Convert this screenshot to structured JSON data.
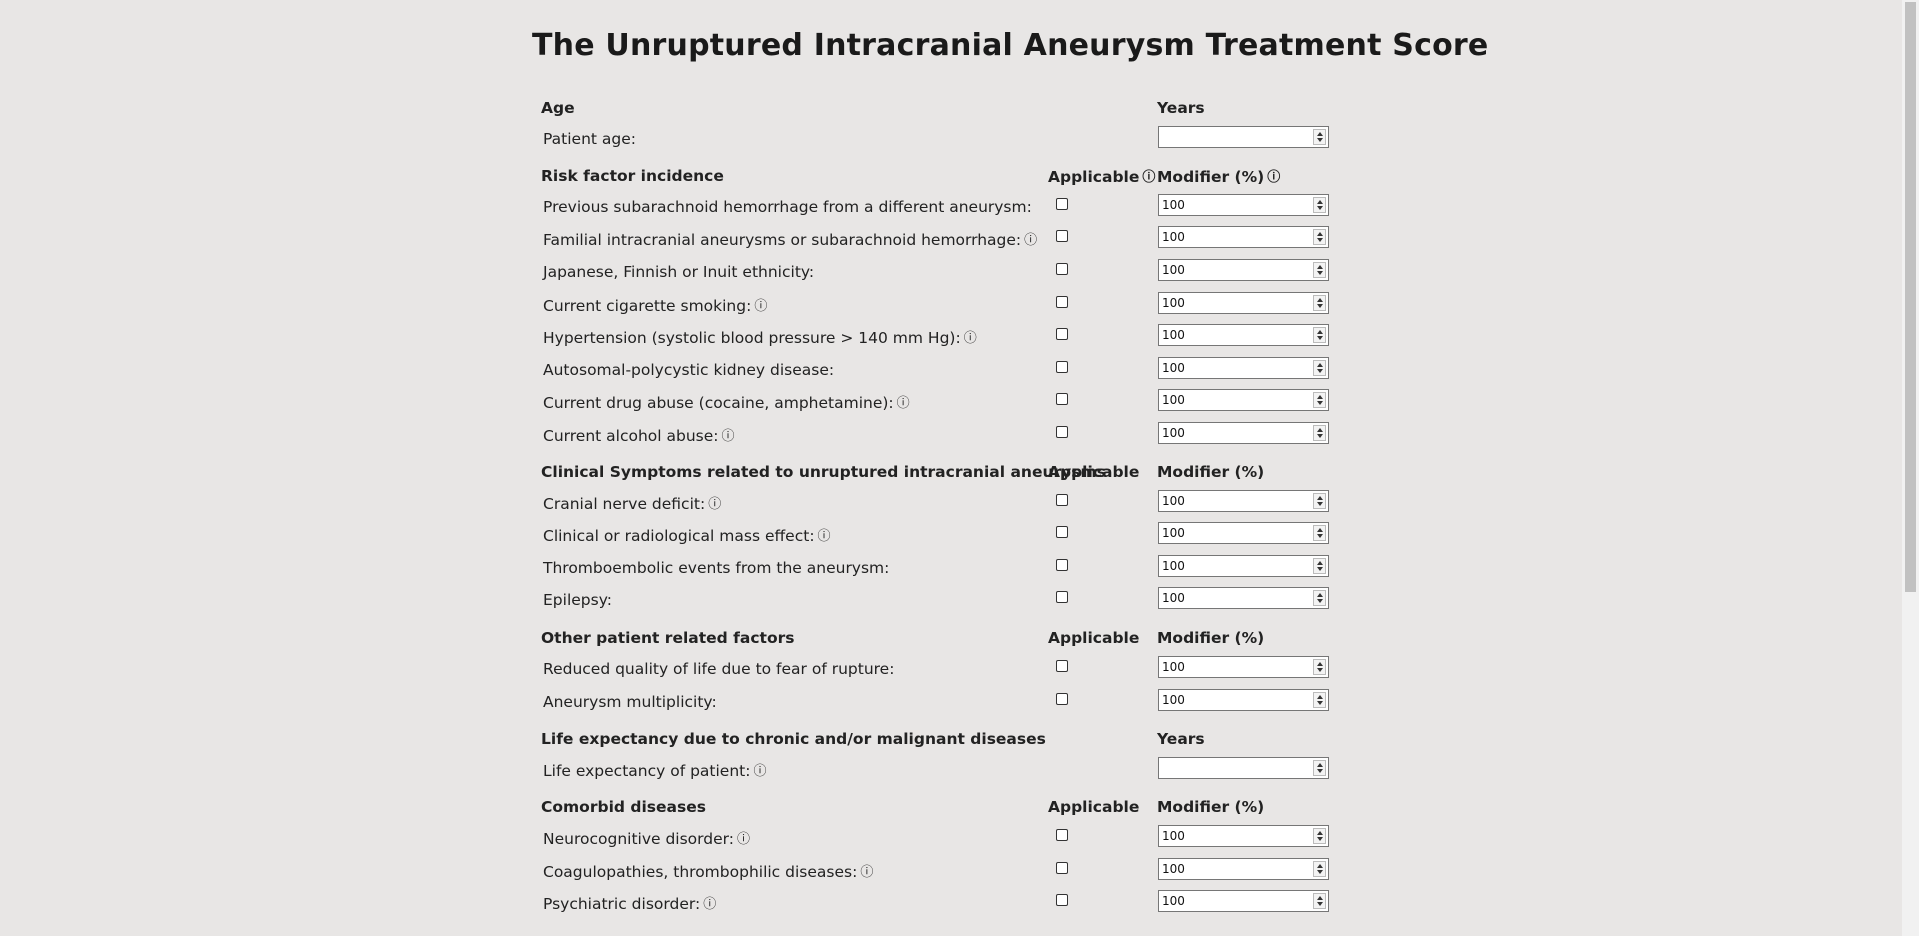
{
  "title": "The Unruptured Intracranial Aneurysm Treatment Score",
  "info_glyph": "ⓘ",
  "sections": {
    "age": {
      "title": "Age",
      "col_mod": "Years",
      "rows": [
        {
          "label": "Patient age:",
          "info": false,
          "value": ""
        }
      ]
    },
    "risk": {
      "title": "Risk factor incidence",
      "col_app": "Applicable",
      "col_mod": "Modifier (%)",
      "rows": [
        {
          "label": "Previous subarachnoid hemorrhage from a different aneurysm:",
          "value": "100"
        },
        {
          "label": "Familial intracranial aneurysms or subarachnoid hemorrhage:",
          "value": "100"
        },
        {
          "label": "Japanese, Finnish or Inuit ethnicity:",
          "value": "100"
        },
        {
          "label": "Current cigarette smoking:",
          "value": "100"
        },
        {
          "label": "Hypertension (systolic blood pressure > 140 mm Hg):",
          "value": "100"
        },
        {
          "label": "Autosomal-polycystic kidney disease:",
          "value": "100"
        },
        {
          "label": "Current drug abuse (cocaine, amphetamine):",
          "value": "100"
        },
        {
          "label": "Current alcohol abuse:",
          "value": "100"
        }
      ]
    },
    "clinical": {
      "title": "Clinical Symptoms related to unruptured intracranial aneurysms",
      "col_app": "Applicable",
      "col_mod": "Modifier (%)",
      "rows": [
        {
          "label": "Cranial nerve deficit:",
          "value": "100"
        },
        {
          "label": "Clinical or radiological mass effect:",
          "value": "100"
        },
        {
          "label": "Thromboembolic events from the aneurysm:",
          "value": "100"
        },
        {
          "label": "Epilepsy:",
          "value": "100"
        }
      ]
    },
    "other": {
      "title": "Other patient related factors",
      "col_app": "Applicable",
      "col_mod": "Modifier (%)",
      "rows": [
        {
          "label": "Reduced quality of life due to fear of rupture:",
          "value": "100"
        },
        {
          "label": "Aneurysm multiplicity:",
          "value": "100"
        }
      ]
    },
    "life": {
      "title": "Life expectancy due to chronic and/or malignant diseases",
      "col_mod": "Years",
      "rows": [
        {
          "label": "Life expectancy of patient:",
          "value": ""
        }
      ]
    },
    "comorbid": {
      "title": "Comorbid diseases",
      "col_app": "Applicable",
      "col_mod": "Modifier (%)",
      "rows": [
        {
          "label": "Neurocognitive disorder:",
          "value": "100"
        },
        {
          "label": "Coagulopathies, thrombophilic diseases:",
          "value": "100"
        },
        {
          "label": "Psychiatric disorder:",
          "value": "100"
        }
      ]
    }
  }
}
